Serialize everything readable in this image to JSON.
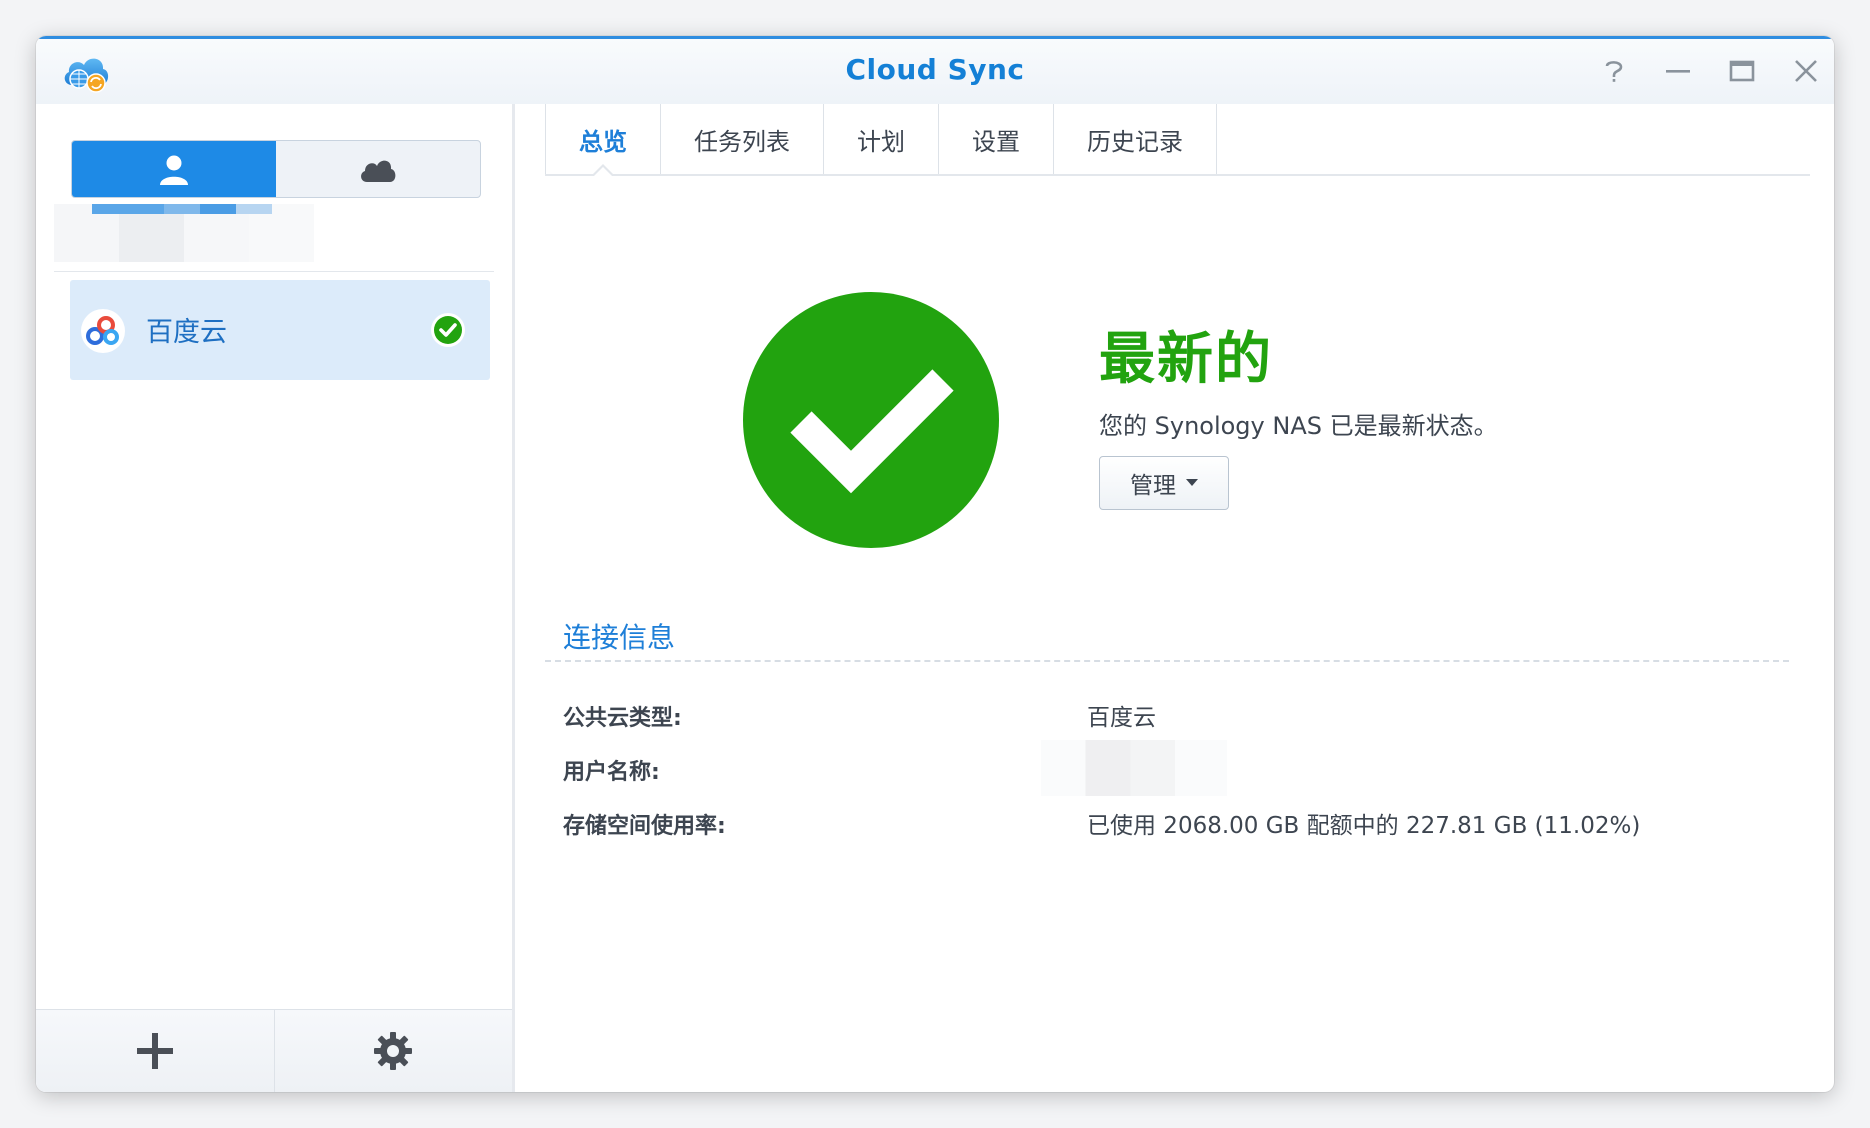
{
  "window": {
    "title": "Cloud Sync",
    "icons": [
      "cloud-sync-app-icon",
      "help-icon",
      "minimize-icon",
      "maximize-icon",
      "close-icon"
    ]
  },
  "sidebar": {
    "segments": [
      {
        "icon": "user-icon",
        "active": true
      },
      {
        "icon": "cloud-icon",
        "active": false
      }
    ],
    "connections": [
      {
        "name": "百度云",
        "status_icon": "check-circle-icon",
        "selected": true
      }
    ],
    "footer": [
      "add-icon",
      "gear-icon"
    ]
  },
  "tabs": [
    {
      "label": "总览",
      "active": true
    },
    {
      "label": "任务列表",
      "active": false
    },
    {
      "label": "计划",
      "active": false
    },
    {
      "label": "设置",
      "active": false
    },
    {
      "label": "历史记录",
      "active": false
    }
  ],
  "status": {
    "title": "最新的",
    "description": "您的 Synology NAS 已是最新状态。",
    "manage_label": "管理",
    "color": "#22a30f"
  },
  "connection_info": {
    "section_title": "连接信息",
    "rows": [
      {
        "label": "公共云类型:",
        "value": "百度云"
      },
      {
        "label": "用户名称:",
        "value": ""
      },
      {
        "label": "存储空间使用率:",
        "value": "已使用 2068.00 GB 配额中的 227.81 GB (11.02%)"
      }
    ]
  },
  "colors": {
    "accent": "#1e8ae6",
    "title_blue": "#1480d6",
    "success": "#22a30f",
    "selected_bg": "#dcebfa"
  }
}
